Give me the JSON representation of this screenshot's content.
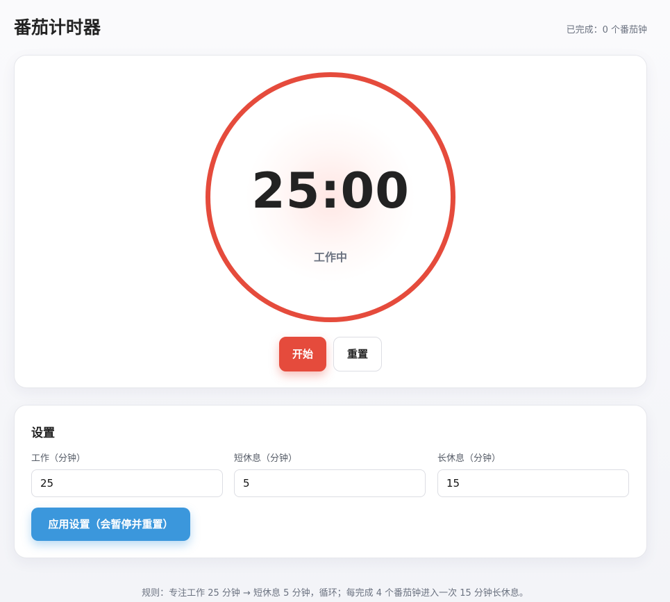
{
  "header": {
    "title": "番茄计时器",
    "completed": "已完成：0 个番茄钟"
  },
  "timer": {
    "time": "25:00",
    "mode": "工作中",
    "start_label": "开始",
    "reset_label": "重置",
    "ring_color": "#e54b3c"
  },
  "settings": {
    "title": "设置",
    "work_label": "工作（分钟）",
    "work_value": "25",
    "short_label": "短休息（分钟）",
    "short_value": "5",
    "long_label": "长休息（分钟）",
    "long_value": "15",
    "apply_label": "应用设置（会暂停并重置）",
    "accent_color": "#3b97dc"
  },
  "footer": {
    "rules": "规则：专注工作 25 分钟 → 短休息 5 分钟，循环；每完成 4 个番茄钟进入一次 15 分钟长休息。"
  }
}
